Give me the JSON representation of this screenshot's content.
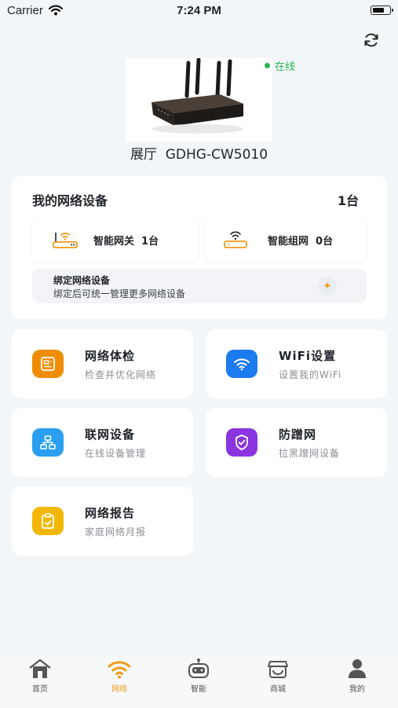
{
  "status_bar": {
    "carrier": "Carrier",
    "time": "7:24 PM"
  },
  "header": {
    "refresh_icon": "refresh-icon"
  },
  "device": {
    "status": "在线",
    "name": "展厅  GDHG-CW5010",
    "image": "router-image"
  },
  "my_devices": {
    "title": "我的网络设备",
    "count": "1台",
    "gateway": {
      "label": "智能网关  1台",
      "icon": "gateway-icon"
    },
    "mesh": {
      "label": "智能组网  0台",
      "icon": "mesh-icon"
    },
    "bind": {
      "title": "绑定网络设备",
      "subtitle": "绑定后可统一管理更多网络设备",
      "icon": "add-icon"
    }
  },
  "features": [
    {
      "title": "网络体检",
      "subtitle": "检查并优化网络",
      "icon": "health-check-icon",
      "color": "#f08c00"
    },
    {
      "title": "WiFi设置",
      "subtitle": "设置我的WiFi",
      "icon": "wifi-icon",
      "color": "#1d7bf0"
    },
    {
      "title": "联网设备",
      "subtitle": "在线设备管理",
      "icon": "network-topology-icon",
      "color": "#2a9ff0"
    },
    {
      "title": "防蹭网",
      "subtitle": "拉黑蹭网设备",
      "icon": "shield-icon",
      "color": "#8a35e0"
    },
    {
      "title": "网络报告",
      "subtitle": "家庭网络月报",
      "icon": "report-icon",
      "color": "#f2b705"
    }
  ],
  "tabbar": [
    {
      "label": "首页",
      "icon": "home-icon"
    },
    {
      "label": "网络",
      "icon": "wifi-icon",
      "active": true
    },
    {
      "label": "智能",
      "icon": "robot-icon"
    },
    {
      "label": "商城",
      "icon": "store-icon"
    },
    {
      "label": "我的",
      "icon": "person-icon"
    }
  ],
  "colors": {
    "accent": "#f09a14",
    "online": "#2cb552",
    "background": "#f3f6f9"
  }
}
